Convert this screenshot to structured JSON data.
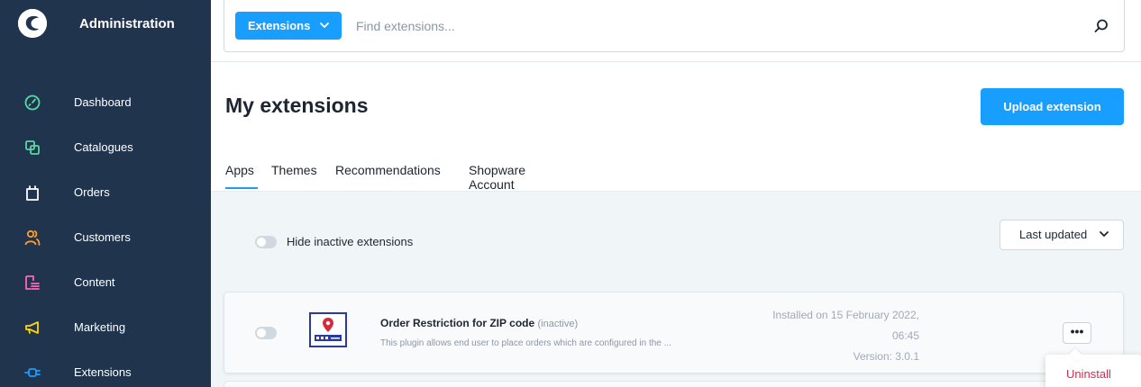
{
  "sidebar": {
    "title": "Administration",
    "items": [
      {
        "label": "Dashboard",
        "icon": "dashboard-icon"
      },
      {
        "label": "Catalogues",
        "icon": "catalogues-icon"
      },
      {
        "label": "Orders",
        "icon": "orders-icon"
      },
      {
        "label": "Customers",
        "icon": "customers-icon"
      },
      {
        "label": "Content",
        "icon": "content-icon"
      },
      {
        "label": "Marketing",
        "icon": "marketing-icon"
      },
      {
        "label": "Extensions",
        "icon": "extensions-icon"
      }
    ],
    "icon_colors": [
      "#57d9a3",
      "#57d9a3",
      "#ffffff",
      "#ff9d2e",
      "#ff68b4",
      "#ffd700",
      "#189eff"
    ]
  },
  "search": {
    "type_label": "Extensions",
    "placeholder": "Find extensions..."
  },
  "page": {
    "title": "My extensions",
    "upload_label": "Upload extension"
  },
  "tabs": [
    {
      "label": "Apps",
      "active": true
    },
    {
      "label": "Themes"
    },
    {
      "label": "Recommendations"
    },
    {
      "label": "Shopware Account"
    }
  ],
  "filters": {
    "hide_inactive_label": "Hide inactive extensions",
    "hide_inactive": false,
    "sort_label": "Last updated"
  },
  "extension": {
    "name": "Order Restriction for ZIP code",
    "status": "(inactive)",
    "description": "This plugin allows end user to place orders which are configured in the ...",
    "installed_line1": "Installed on 15 February 2022,",
    "installed_line2": "06:45",
    "version": "Version: 3.0.1",
    "active": false,
    "more_label": "•••"
  },
  "context_menu": {
    "items": [
      "Uninstall"
    ]
  },
  "colors": {
    "accent": "#189eff",
    "sidebar": "#20344e",
    "danger": "#de294c"
  }
}
